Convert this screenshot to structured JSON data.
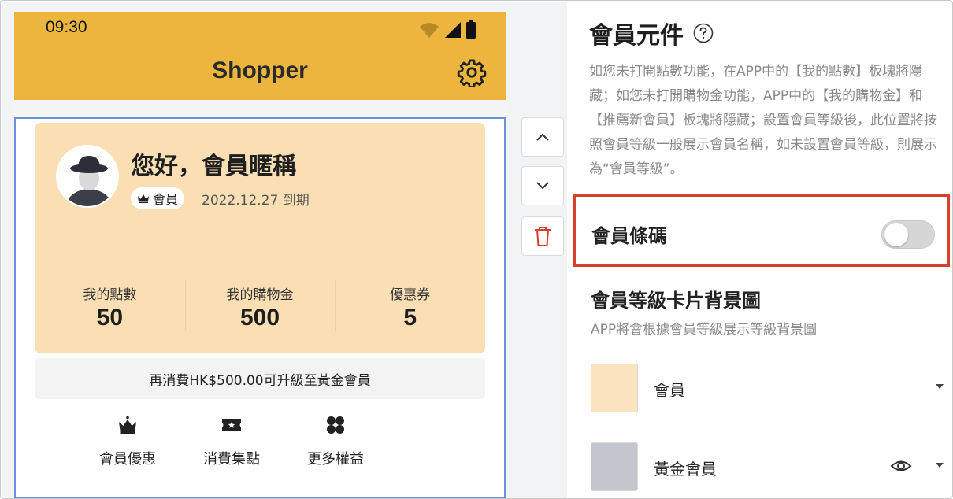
{
  "status_bar": {
    "time": "09:30"
  },
  "app": {
    "title": "Shopper"
  },
  "member_card": {
    "greeting": "您好，會員暱稱",
    "badge_label": "會員",
    "expiry": "2022.12.27 到期",
    "stats": [
      {
        "label": "我的點數",
        "value": "50"
      },
      {
        "label": "我的購物金",
        "value": "500"
      },
      {
        "label": "優惠券",
        "value": "5"
      }
    ]
  },
  "upgrade_text": "再消費HK$500.00可升級至黃金會員",
  "benefits": [
    {
      "label": "會員優惠",
      "icon": "crown-icon"
    },
    {
      "label": "消費集點",
      "icon": "ticket-icon"
    },
    {
      "label": "更多權益",
      "icon": "clover-icon"
    }
  ],
  "panel": {
    "title": "會員元件",
    "description": "如您未打開點數功能，在APP中的【我的點數】板塊將隱藏；如您未打開購物金功能，APP中的【我的購物金】和【推薦新會員】板塊將隱藏；設置會員等級後，此位置將按照會員等級一般展示會員名稱，如未設置會員等級，則展示為“會員等級”。",
    "barcode_label": "會員條碼",
    "barcode_enabled": false,
    "section_title": "會員等級卡片背景圖",
    "section_subtitle": "APP將會根據會員等級展示等級背景圖",
    "levels": [
      {
        "name": "會員",
        "color": "#fae3bd"
      },
      {
        "name": "黃金會員",
        "color": "#c3c7cd"
      }
    ]
  },
  "colors": {
    "appbar": "#ecb63e",
    "card": "#fadfb4",
    "highlight_border": "#d9402b",
    "selection_border": "#6b8fd8"
  }
}
